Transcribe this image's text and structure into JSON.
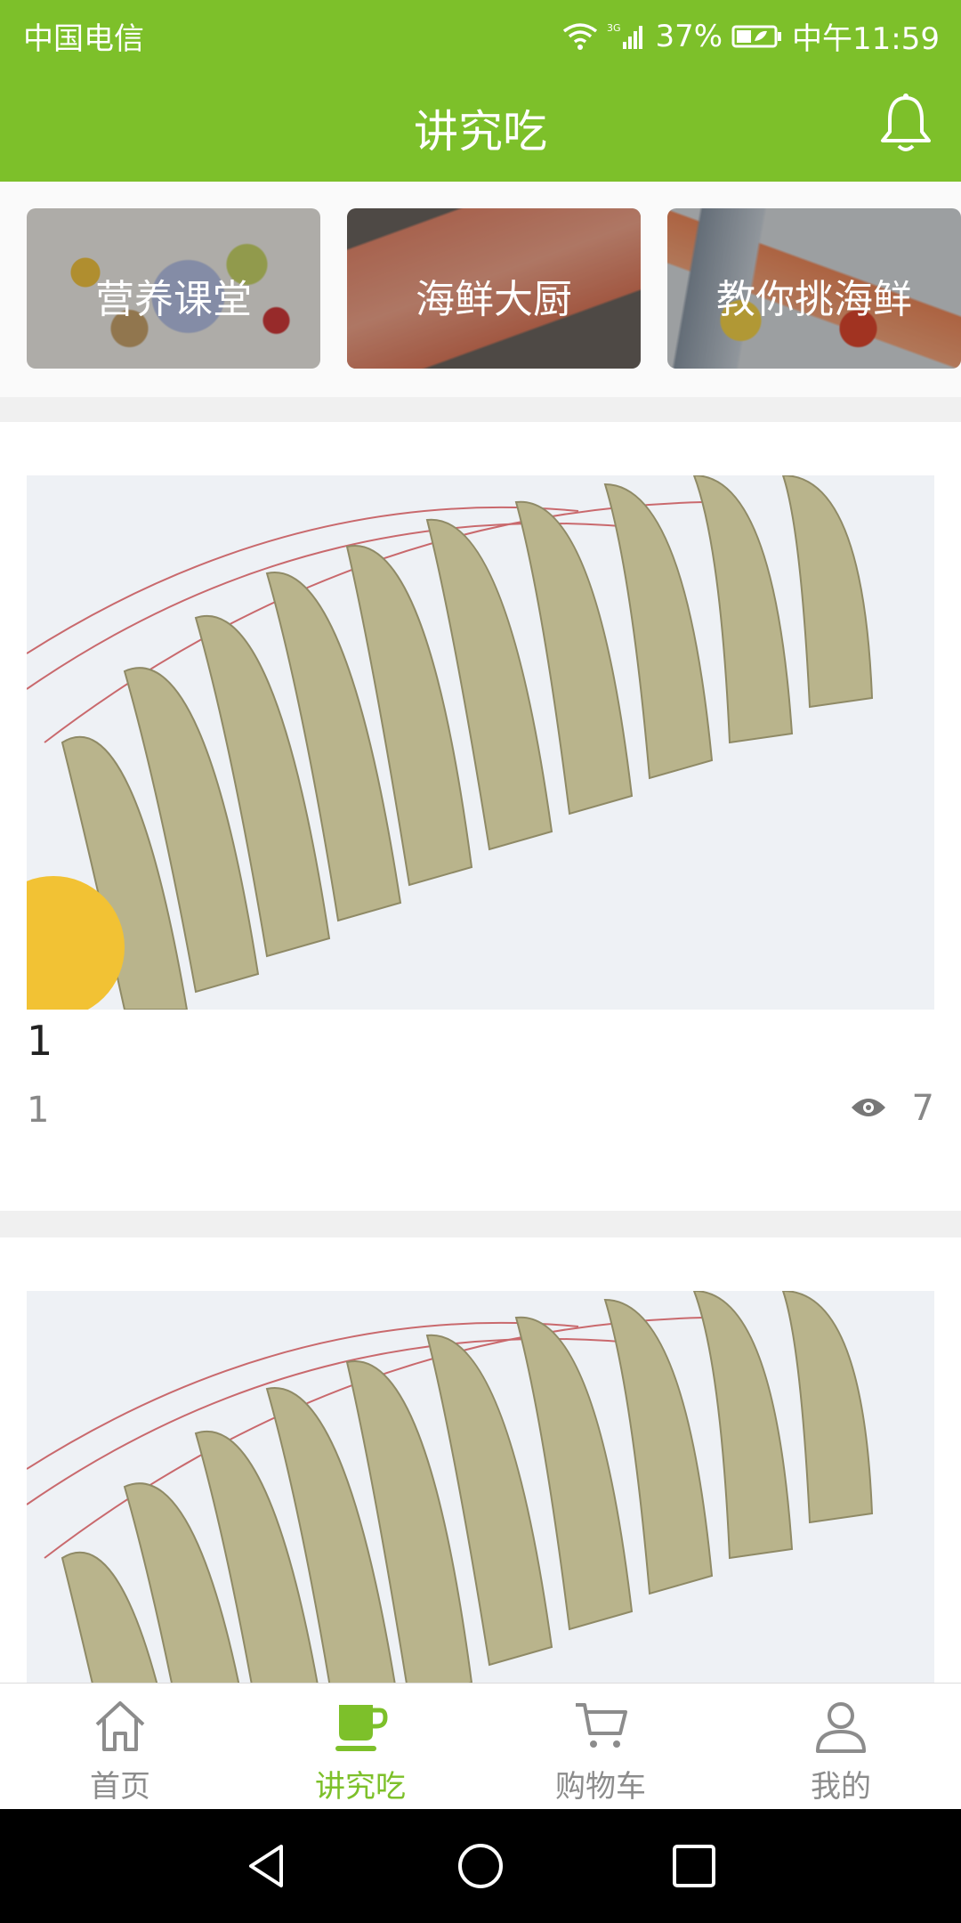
{
  "status": {
    "carrier": "中国电信",
    "network": "3G",
    "battery": "37%",
    "time": "中午11:59"
  },
  "header": {
    "title": "讲究吃"
  },
  "categories": [
    {
      "label": "营养课堂"
    },
    {
      "label": "海鲜大厨"
    },
    {
      "label": "教你挑海鲜"
    }
  ],
  "posts": [
    {
      "title": "1",
      "subtitle": "1",
      "views": "7"
    },
    {
      "title": "",
      "subtitle": "",
      "views": ""
    }
  ],
  "nav": [
    {
      "label": "首页"
    },
    {
      "label": "讲究吃"
    },
    {
      "label": "购物车"
    },
    {
      "label": "我的"
    }
  ],
  "colors": {
    "accent": "#7dc02a"
  }
}
